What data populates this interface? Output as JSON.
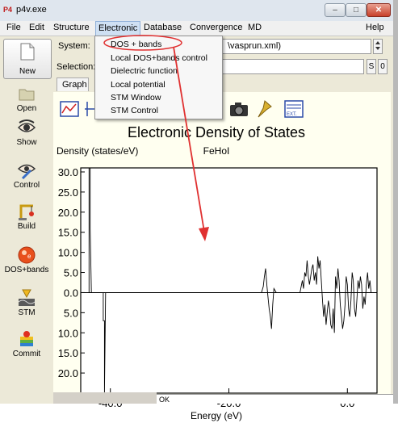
{
  "window": {
    "title": "p4v.exe",
    "app_icon_text": "P4",
    "controls": [
      "–",
      "□",
      "✕"
    ]
  },
  "menubar": {
    "items": [
      "File",
      "Edit",
      "Structure",
      "Electronic",
      "Database",
      "Convergence",
      "MD",
      "Help"
    ]
  },
  "toolbar": {
    "new_label": "New",
    "open_label": "Open",
    "show_label": "Show",
    "control_label": "Control",
    "build_label": "Build",
    "dosbands_label": "DOS+bands",
    "stm_label": "STM",
    "commit_label": "Commit"
  },
  "system": {
    "label": "System:",
    "value": "\\vasprun.xml)"
  },
  "selection": {
    "label": "Selection:",
    "value": "",
    "btn_s": "S",
    "btn_0": "0"
  },
  "tabs": {
    "graph": "Graph"
  },
  "electronic_menu": {
    "items": [
      "DOS + bands",
      "Local DOS+bands control",
      "Dielectric function",
      "Local potential",
      "STM Window",
      "STM Control"
    ]
  },
  "graph_icons": [
    "line-graph-icon",
    "arrow-graph-icon",
    "camera-icon",
    "pin-icon",
    "export-icon"
  ],
  "export_icon_text": "EXT.",
  "status": {
    "text": "OK"
  },
  "chart_data": {
    "type": "line",
    "title": "Electronic Density of States",
    "subtitle": "FeHoI",
    "ylabel": "Density (states/eV)",
    "xlabel": "Energy (eV)",
    "xlim": [
      -45,
      5
    ],
    "ylim": [
      -25,
      31
    ],
    "x_ticks": [
      -40.0,
      -20.0,
      0.0
    ],
    "x_tick_labels": [
      "-40.0",
      "-20.0",
      "0.0"
    ],
    "y_ticks": [
      30,
      25,
      20,
      15,
      10,
      5,
      0,
      -5,
      -10,
      -15,
      -20
    ],
    "y_tick_labels": [
      "30.0",
      "25.0",
      "20.0",
      "15.0",
      "10.0",
      "5.0",
      "0.0",
      "5.0",
      "10.0",
      "15.0",
      "20.0"
    ],
    "series": [
      {
        "x": [
          -45,
          -44,
          -43.6,
          -43.6,
          -43.4,
          -43.4,
          -43.2,
          -42,
          -41.2,
          -41.2,
          -41.0,
          -41.0,
          -40.8,
          -28,
          -14.5,
          -14.2,
          -14.0,
          -13.8,
          -13.6,
          -13.4,
          -13.2,
          -13.0,
          -12.8,
          -12.6,
          -12.4,
          -12.0,
          -10,
          -8.0,
          -7.6,
          -7.4,
          -7.2,
          -7.0,
          -6.8,
          -6.6,
          -6.4,
          -6.2,
          -6.0,
          -5.8,
          -5.6,
          -5.4,
          -5.2,
          -5.0,
          -4.8,
          -4.6,
          -4.4,
          -4.2,
          -4.0,
          -3.8,
          -3.6,
          -3.4,
          -3.2,
          -3.0,
          -2.8,
          -2.6,
          -2.4,
          -2.2,
          -2.0,
          -1.8,
          -1.6,
          -1.4,
          -1.2,
          -1.0,
          -0.8,
          -0.6,
          -0.4,
          -0.2,
          0.0,
          0.2,
          0.4,
          0.6,
          0.8,
          1.0,
          1.2,
          1.4,
          1.6,
          1.8,
          2.0,
          2.2,
          2.4,
          2.6,
          2.8,
          3.0,
          3.2,
          3.4,
          3.6,
          3.8,
          4.0,
          5.0
        ],
        "y": [
          0,
          0,
          0,
          31,
          31,
          16,
          0,
          0,
          0,
          -7,
          -7,
          -25,
          0,
          0,
          0,
          1.5,
          4,
          6,
          2,
          -1,
          -4,
          -6,
          -9,
          -3,
          1,
          0,
          0,
          0,
          3,
          1,
          5,
          4,
          8,
          4,
          2,
          4,
          6,
          7,
          3,
          5,
          2,
          9,
          6,
          8,
          3,
          -2,
          -6,
          -3,
          -8,
          -5,
          -2,
          -4,
          -8,
          -9,
          -4,
          -10,
          4,
          1,
          6,
          3,
          -3,
          -6,
          -9,
          -7,
          -3,
          4,
          2,
          -4,
          -6,
          -2,
          5,
          3,
          -4,
          -6,
          -2,
          3,
          1,
          4,
          2,
          -4,
          -1,
          -3,
          2,
          5,
          1,
          3,
          0,
          0
        ]
      }
    ],
    "grid": false
  },
  "colors": {
    "plot_bg": "#ffffff",
    "panel_bg": "#fffff0",
    "annotation_red": "#e03030",
    "menu_highlight": "#cfe0f3"
  }
}
